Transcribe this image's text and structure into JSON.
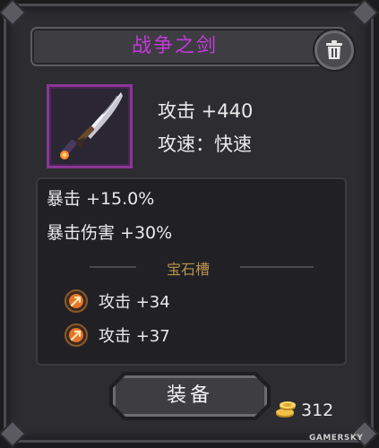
{
  "item": {
    "name": "战争之剑",
    "name_color": "#c43ad9",
    "rarity_frame_color": "#8a3696",
    "icon": "curved-sword-icon",
    "attack": "攻击 +440",
    "attack_speed": "攻速：快速"
  },
  "stats": {
    "crit": "暴击 +15.0%",
    "crit_damage": "暴击伤害 +30%"
  },
  "gem_slots": {
    "title": "宝石槽",
    "gems": [
      {
        "label": "攻击 +34",
        "icon": "arrow-gem-icon"
      },
      {
        "label": "攻击 +37",
        "icon": "arrow-gem-icon"
      }
    ]
  },
  "actions": {
    "equip_label": "装备",
    "delete_icon": "trash-icon"
  },
  "price": {
    "amount": "312",
    "icon": "gold-coins-icon"
  },
  "watermark": "GAMERSKY"
}
